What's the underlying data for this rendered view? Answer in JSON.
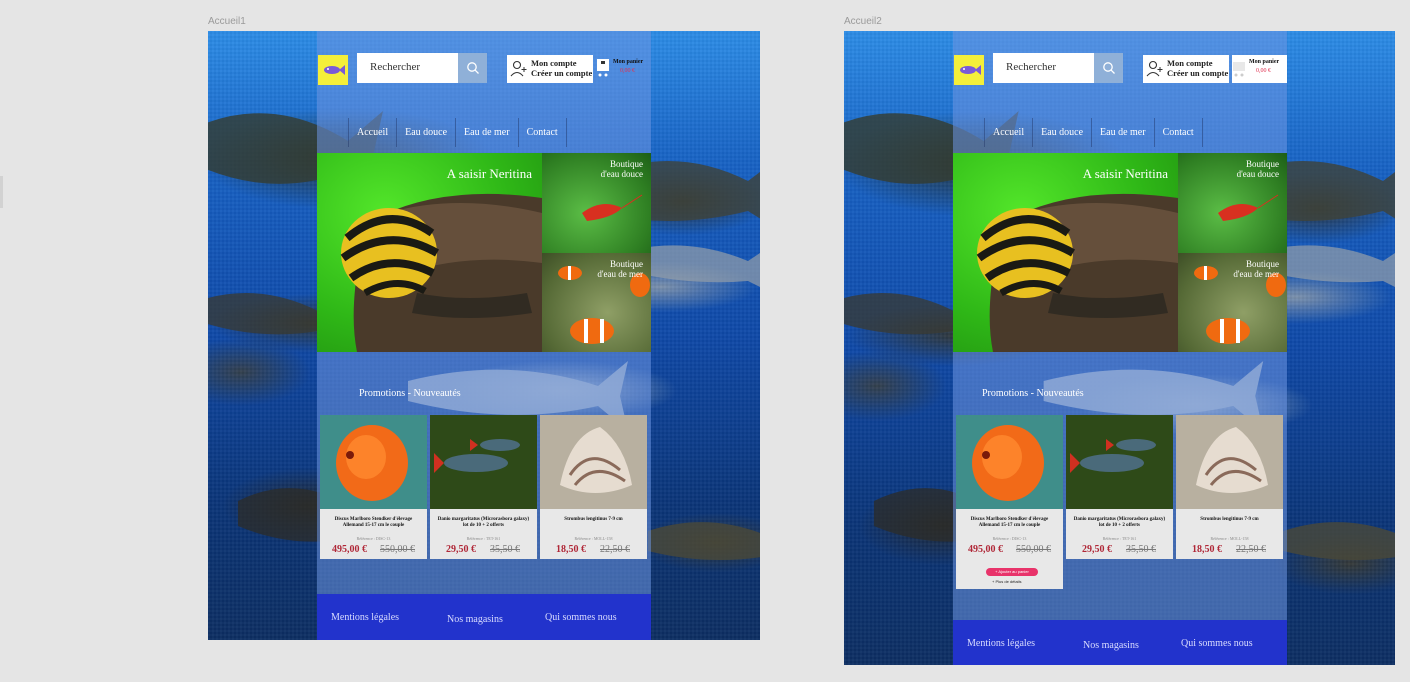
{
  "artboards": [
    {
      "label": "Accueil1",
      "header": {
        "search_placeholder": "Rechercher",
        "account_line1": "Mon compte",
        "account_line2": "Créer un compte",
        "cart_label": "Mon panier",
        "cart_total": "0,00 €"
      },
      "nav": [
        "Accueil",
        "Eau douce",
        "Eau de mer",
        "Contact"
      ],
      "hero": {
        "title": "A saisir Neritina",
        "side1": [
          "Boutique",
          "d'eau douce"
        ],
        "side2": [
          "Boutique",
          "d'eau de mer"
        ]
      },
      "promo_title": "Promotions - Nouveautés",
      "products": [
        {
          "name": "Discus Marlboro Stendker d'élevage Allemand 15-17 cm le couple",
          "ref": "Référence : DISC-13",
          "price": "495,00 €",
          "old_price": "550,00 €"
        },
        {
          "name": "Danio margaritatus (Microrasbora galaxy) lot de 10 + 2 offerts",
          "ref": "Référence : TET-161",
          "price": "29,50 €",
          "old_price": "35,50 €"
        },
        {
          "name": "Strombus lengitinus 7-9 cm",
          "ref": "Référence : MOLL-158",
          "price": "18,50 €",
          "old_price": "22,50 €"
        }
      ],
      "footer": [
        "Mentions légales",
        "Nos magasins",
        "Qui sommes nous"
      ]
    },
    {
      "label": "Accueil2",
      "header": {
        "search_placeholder": "Rechercher",
        "account_line1": "Mon compte",
        "account_line2": "Créer un compte",
        "cart_label": "Mon panier",
        "cart_total": "0,00 €"
      },
      "nav": [
        "Accueil",
        "Eau douce",
        "Eau de mer",
        "Contact"
      ],
      "hero": {
        "title": "A saisir Neritina",
        "side1": [
          "Boutique",
          "d'eau douce"
        ],
        "side2": [
          "Boutique",
          "d'eau de mer"
        ]
      },
      "promo_title": "Promotions - Nouveautés",
      "products": [
        {
          "name": "Discus Marlboro Stendker d'élevage Allemand 15-17 cm le couple",
          "ref": "Référence : DISC-13",
          "price": "495,00 €",
          "old_price": "550,00 €",
          "add_to_cart": "+ Ajouter au panier",
          "more_details": "+ Plus de détails"
        },
        {
          "name": "Danio margaritatus (Microrasbora galaxy) lot de 10 + 2 offerts",
          "ref": "Référence : TET-161",
          "price": "29,50 €",
          "old_price": "35,50 €"
        },
        {
          "name": "Strombus lengitinus 7-9 cm",
          "ref": "Référence : MOLL-158",
          "price": "18,50 €",
          "old_price": "22,50 €"
        }
      ],
      "footer": [
        "Mentions légales",
        "Nos magasins",
        "Qui sommes nous"
      ]
    }
  ],
  "colors": {
    "canvas": "#e5e5e5",
    "footer": "#2233cc",
    "price": "#b02838",
    "add_button": "#e8336a",
    "logo": "#f4ef3a"
  }
}
